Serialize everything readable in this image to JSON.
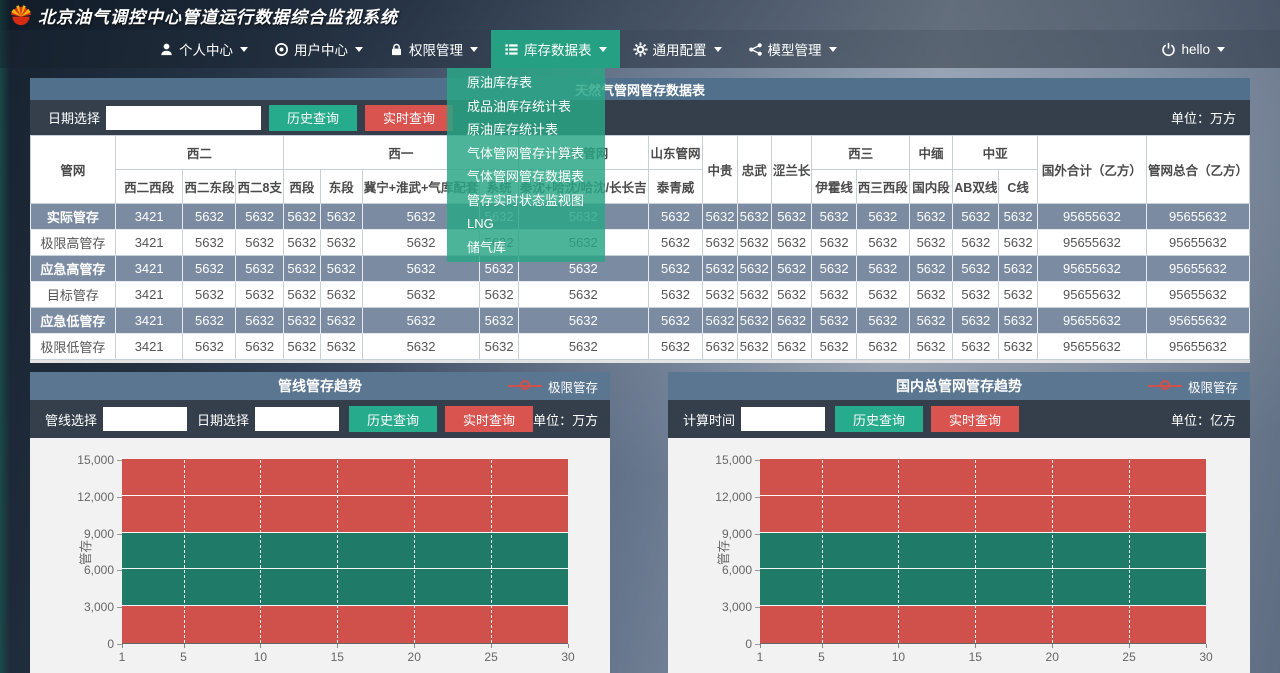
{
  "brand": {
    "title": "北京油气调控中心管道运行数据综合监视系统"
  },
  "nav": {
    "items": [
      {
        "label": "个人中心",
        "icon": "user-icon",
        "active": false
      },
      {
        "label": "用户中心",
        "icon": "user-circle-icon",
        "active": false
      },
      {
        "label": "权限管理",
        "icon": "lock-icon",
        "active": false
      },
      {
        "label": "库存数据表",
        "icon": "list-icon",
        "active": true
      },
      {
        "label": "通用配置",
        "icon": "gear-icon",
        "active": false
      },
      {
        "label": "模型管理",
        "icon": "share-icon",
        "active": false
      }
    ],
    "user": {
      "label": "hello",
      "icon": "power-icon"
    }
  },
  "dropdown": {
    "items": [
      "原油库存表",
      "成品油库存统计表",
      "原油库存统计表",
      "气体管网管存计算表",
      "气体管网管存数据表",
      "管存实时状态监视图",
      "LNG",
      "储气库"
    ]
  },
  "inventory_table": {
    "title": "天然气管网管存数据表",
    "toolbar": {
      "date_label": "日期选择",
      "date_value": "",
      "history_btn": "历史查询",
      "realtime_btn": "实时查询",
      "unit": "单位：万方"
    },
    "header": {
      "corner": "管网",
      "groups": [
        {
          "label": "西二",
          "children": [
            "西二西段",
            "西二东段",
            "西二8支"
          ]
        },
        {
          "label": "西一",
          "children": [
            "西段",
            "东段",
            "冀宁+淮武+气库配套",
            "系统"
          ]
        },
        {
          "label": "东北管网",
          "children": [
            "秦沈+哈沈/哈沈/长长吉"
          ]
        },
        {
          "label": "山东管网",
          "children": [
            "泰青威"
          ]
        },
        {
          "label": "中贵",
          "children": null
        },
        {
          "label": "忠武",
          "children": null
        },
        {
          "label": "涩兰长",
          "children": null
        },
        {
          "label": "西三",
          "children": [
            "伊霍线",
            "西三西段"
          ]
        },
        {
          "label": "中缅",
          "children": [
            "国内段"
          ]
        },
        {
          "label": "中亚",
          "children": [
            "AB双线",
            "C线"
          ]
        },
        {
          "label": "国外合计（乙方）",
          "children": null
        },
        {
          "label": "管网总合（乙方）",
          "children": null
        }
      ]
    },
    "rows": [
      {
        "label": "实际管存",
        "highlight": true,
        "values": [
          "3421",
          "5632",
          "5632",
          "5632",
          "5632",
          "5632",
          "5632",
          "5632",
          "5632",
          "5632",
          "5632",
          "5632",
          "5632",
          "5632",
          "5632",
          "5632",
          "5632",
          "95655632",
          "95655632"
        ]
      },
      {
        "label": "极限高管存",
        "highlight": false,
        "values": [
          "3421",
          "5632",
          "5632",
          "5632",
          "5632",
          "5632",
          "5632",
          "5632",
          "5632",
          "5632",
          "5632",
          "5632",
          "5632",
          "5632",
          "5632",
          "5632",
          "5632",
          "95655632",
          "95655632"
        ]
      },
      {
        "label": "应急高管存",
        "highlight": true,
        "values": [
          "3421",
          "5632",
          "5632",
          "5632",
          "5632",
          "5632",
          "5632",
          "5632",
          "5632",
          "5632",
          "5632",
          "5632",
          "5632",
          "5632",
          "5632",
          "5632",
          "5632",
          "95655632",
          "95655632"
        ]
      },
      {
        "label": "目标管存",
        "highlight": false,
        "values": [
          "3421",
          "5632",
          "5632",
          "5632",
          "5632",
          "5632",
          "5632",
          "5632",
          "5632",
          "5632",
          "5632",
          "5632",
          "5632",
          "5632",
          "5632",
          "5632",
          "5632",
          "95655632",
          "95655632"
        ]
      },
      {
        "label": "应急低管存",
        "highlight": true,
        "values": [
          "3421",
          "5632",
          "5632",
          "5632",
          "5632",
          "5632",
          "5632",
          "5632",
          "5632",
          "5632",
          "5632",
          "5632",
          "5632",
          "5632",
          "5632",
          "5632",
          "5632",
          "95655632",
          "95655632"
        ]
      },
      {
        "label": "极限低管存",
        "highlight": false,
        "values": [
          "3421",
          "5632",
          "5632",
          "5632",
          "5632",
          "5632",
          "5632",
          "5632",
          "5632",
          "5632",
          "5632",
          "5632",
          "5632",
          "5632",
          "5632",
          "5632",
          "5632",
          "95655632",
          "95655632"
        ]
      }
    ]
  },
  "chart_panels": [
    {
      "inputs": [
        {
          "label": "管线选择",
          "value": ""
        },
        {
          "label": "日期选择",
          "value": ""
        }
      ],
      "history_btn": "历史查询",
      "realtime_btn": "实时查询",
      "unit": "单位：万方"
    },
    {
      "inputs": [
        {
          "label": "计算时间",
          "value": ""
        }
      ],
      "history_btn": "历史查询",
      "realtime_btn": "实时查询",
      "unit": "单位：亿方"
    }
  ],
  "chart_data": [
    {
      "type": "bar",
      "title": "管线管存趋势",
      "ylabel": "管存",
      "xlabel": "",
      "legend": [
        {
          "label": "极限管存",
          "color": "#d0504b",
          "position": "top-right"
        }
      ],
      "x_ticks": [
        1,
        5,
        10,
        15,
        20,
        25,
        30
      ],
      "x_range": [
        1,
        30
      ],
      "ylim": [
        0,
        15000
      ],
      "y_ticks": [
        0,
        3000,
        6000,
        9000,
        12000,
        15000
      ],
      "grid": true,
      "bands": [
        {
          "name": "low-limit-zone",
          "from": 0,
          "to": 3000,
          "color": "#d0504b"
        },
        {
          "name": "normal-zone",
          "from": 3000,
          "to": 9000,
          "color": "#1f7a68"
        },
        {
          "name": "high-limit-zone",
          "from": 9000,
          "to": 15000,
          "color": "#d0504b"
        }
      ],
      "unit": "万方"
    },
    {
      "type": "bar",
      "title": "国内总管网管存趋势",
      "ylabel": "管存",
      "xlabel": "",
      "legend": [
        {
          "label": "极限管存",
          "color": "#d0504b",
          "position": "top-right"
        }
      ],
      "x_ticks": [
        1,
        5,
        10,
        15,
        20,
        25,
        30
      ],
      "x_range": [
        1,
        30
      ],
      "ylim": [
        0,
        15000
      ],
      "y_ticks": [
        0,
        3000,
        6000,
        9000,
        12000,
        15000
      ],
      "grid": true,
      "bands": [
        {
          "name": "low-limit-zone",
          "from": 0,
          "to": 3000,
          "color": "#d0504b"
        },
        {
          "name": "normal-zone",
          "from": 3000,
          "to": 9000,
          "color": "#1f7a68"
        },
        {
          "name": "high-limit-zone",
          "from": 9000,
          "to": 15000,
          "color": "#d0504b"
        }
      ],
      "unit": "亿方"
    }
  ]
}
